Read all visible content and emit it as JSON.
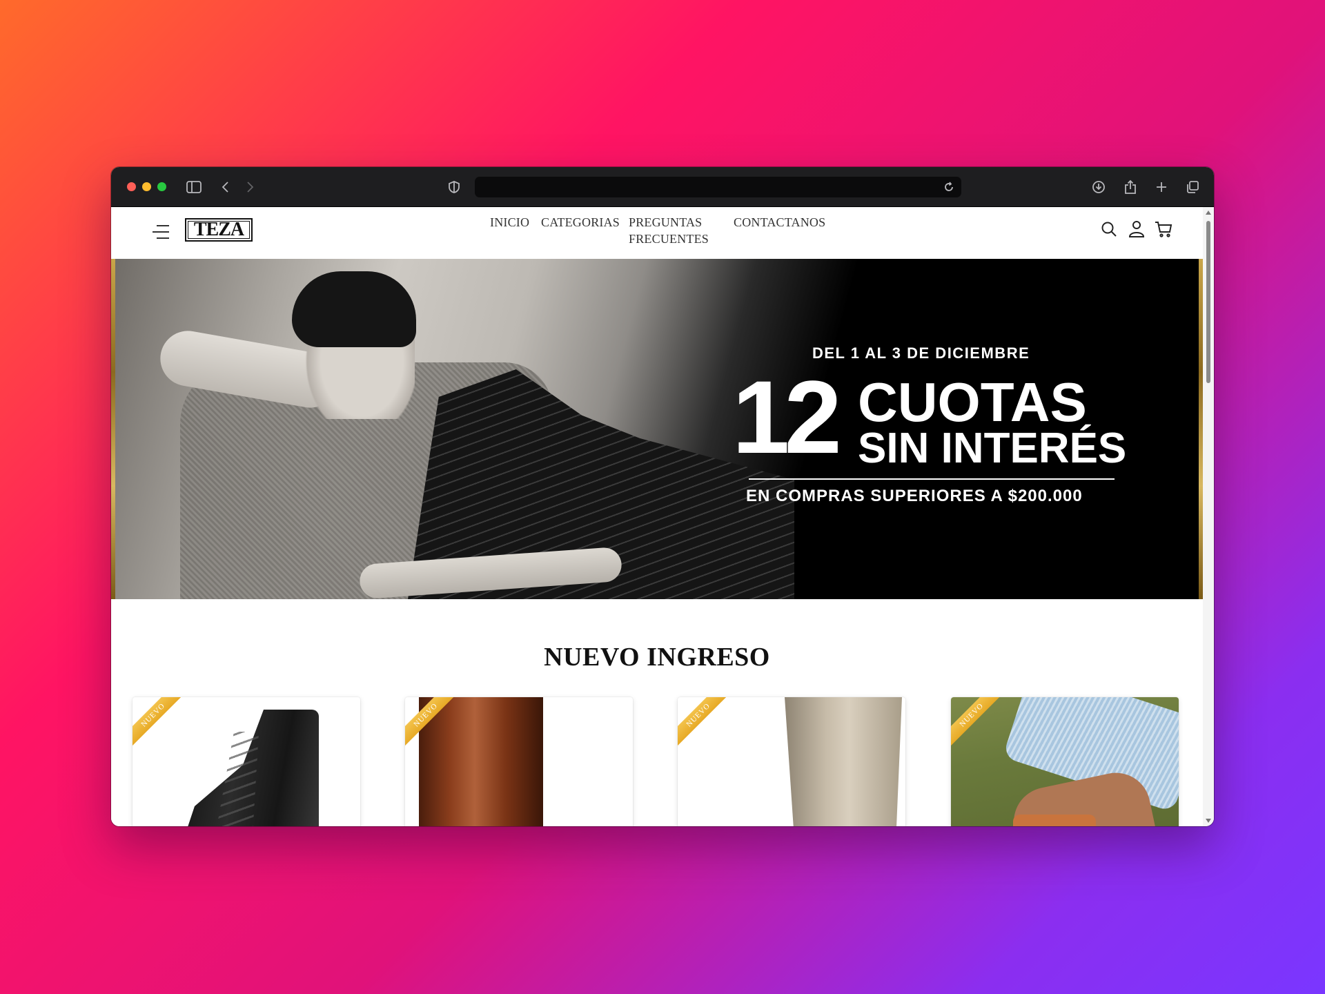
{
  "browser": {
    "url": "",
    "icons": [
      "sidebar-icon",
      "back-icon",
      "forward-icon",
      "shield-icon",
      "reload-icon",
      "download-icon",
      "share-icon",
      "new-tab-icon",
      "tabs-overview-icon"
    ]
  },
  "site": {
    "logo": "TEZA",
    "nav": [
      {
        "label": "INICIO"
      },
      {
        "label": "CATEGORIAS"
      },
      {
        "label": "PREGUNTAS",
        "label2": "FRECUENTES"
      },
      {
        "label": "CONTACTANOS"
      }
    ],
    "header_icons": [
      "search-icon",
      "user-icon",
      "cart-icon"
    ]
  },
  "hero": {
    "date_line": "DEL 1 AL 3 DE DICIEMBRE",
    "number": "12",
    "line1": "CUOTAS",
    "line2": "SIN INTERÉS",
    "footer": "EN COMPRAS SUPERIORES A $200.000"
  },
  "section": {
    "title": "NUEVO INGRESO"
  },
  "products": [
    {
      "badge": "NUEVO"
    },
    {
      "badge": "NUEVO"
    },
    {
      "badge": "NUEVO"
    },
    {
      "badge": "NUEVO"
    }
  ],
  "colors": {
    "accent_badge": "#e7a925",
    "titlebar": "#1e1e20",
    "hero_bg": "#000000"
  }
}
